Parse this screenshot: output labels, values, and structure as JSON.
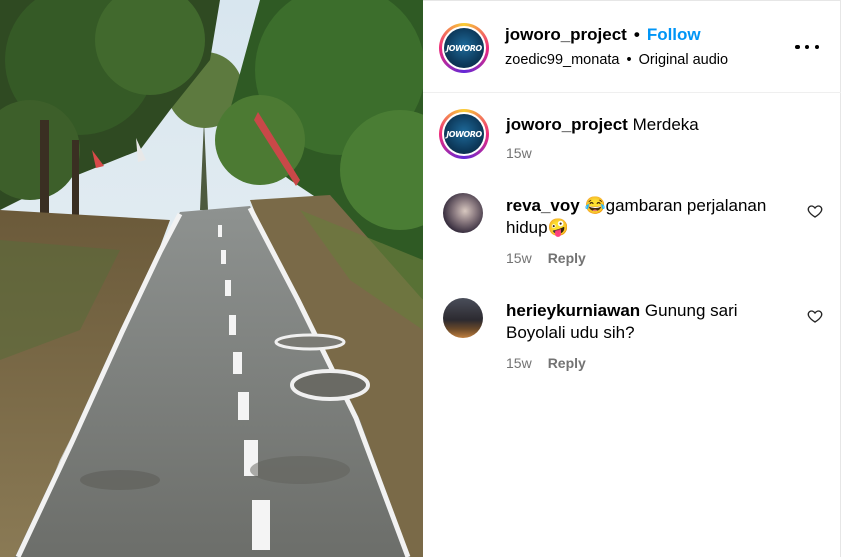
{
  "header": {
    "username": "joworo_project",
    "separator": "•",
    "follow_label": "Follow",
    "audio_user": "zoedic99_monata",
    "audio_sep": "•",
    "audio_label": "Original audio",
    "avatar_text": "JOWORO",
    "more_icon": "more-horizontal-icon"
  },
  "caption": {
    "username": "joworo_project",
    "text": "Merdeka",
    "age": "15w"
  },
  "comments": [
    {
      "username": "reva_voy",
      "emoji_before": "😂",
      "text": "gambaran perjalanan hidup",
      "emoji_after": "🤪",
      "age": "15w",
      "reply_label": "Reply"
    },
    {
      "username": "herieykurniawan",
      "text": "Gunung sari Boyolali udu sih?",
      "age": "15w",
      "reply_label": "Reply"
    }
  ],
  "colors": {
    "follow": "#0095f6",
    "meta": "#737373"
  }
}
